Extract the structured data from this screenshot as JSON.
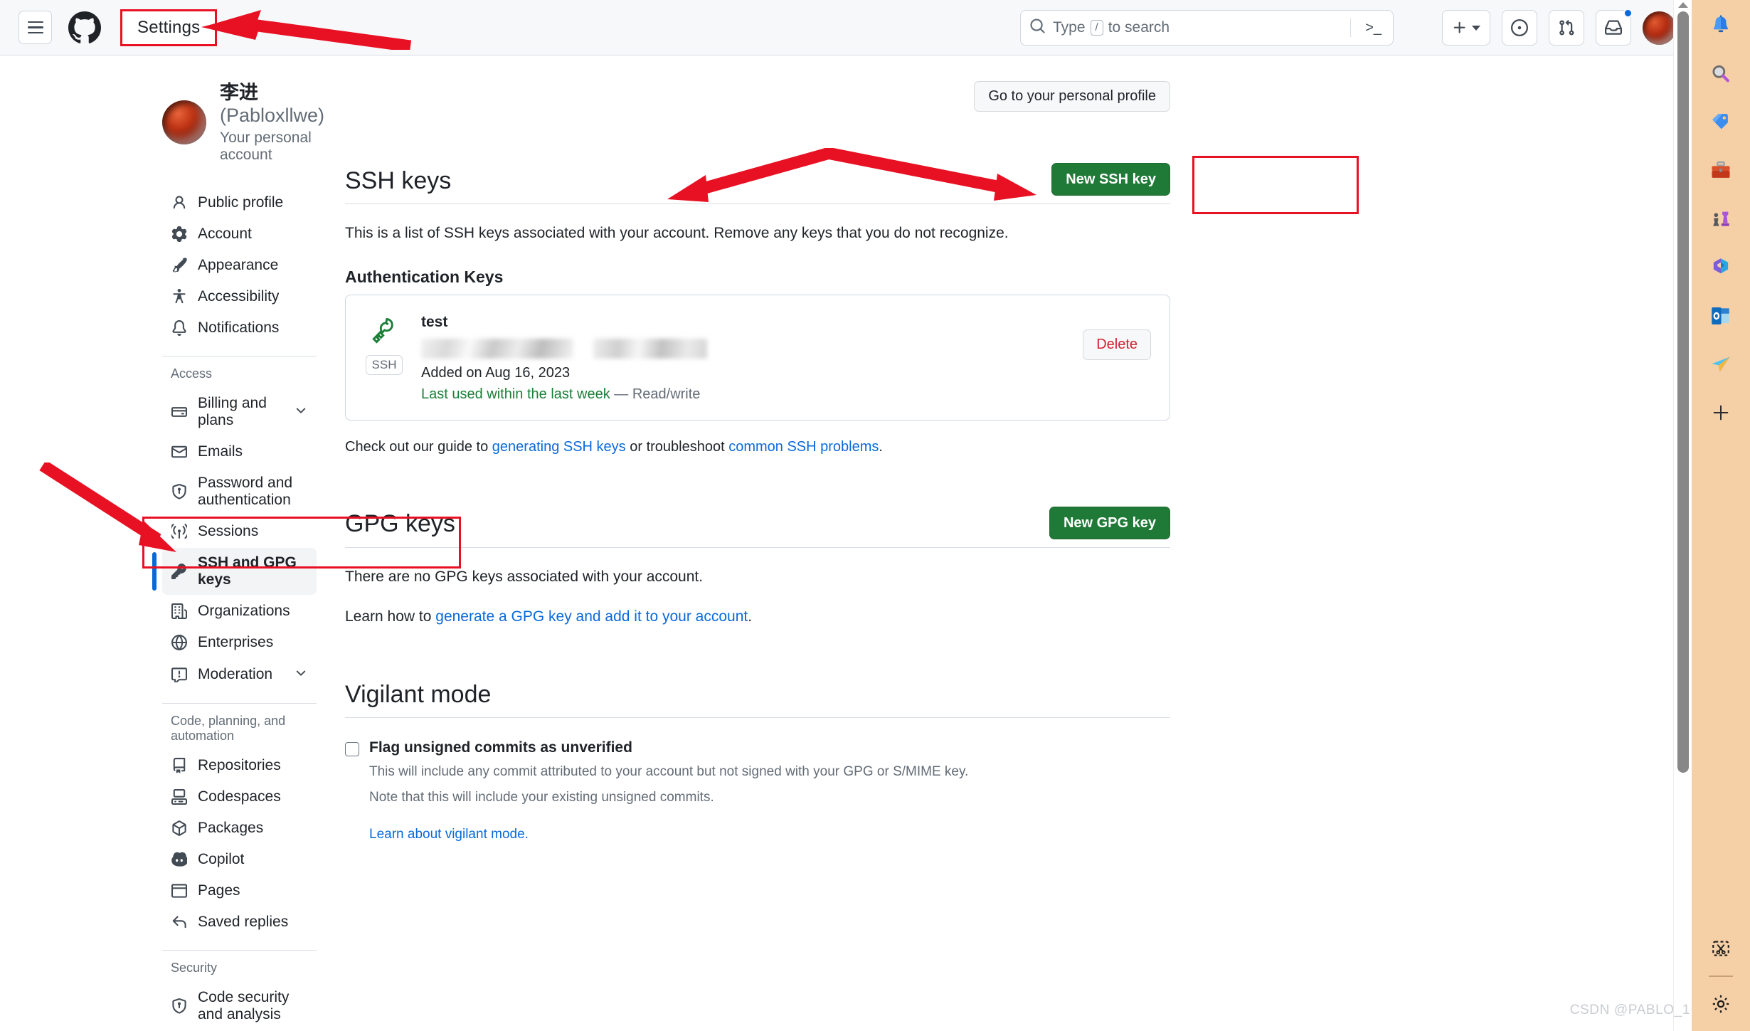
{
  "header": {
    "menu_label": "menu",
    "logo_label": "GitHub",
    "settings_label": "Settings",
    "search_placeholder": "Type",
    "search_key": "/",
    "search_suffix": "to search",
    "terminal_glyph": ">_",
    "create_label": "+",
    "issues_label": "Issues",
    "pull_requests_label": "Pull requests",
    "inbox_label": "Inbox",
    "avatar_label": "Your profile"
  },
  "profile": {
    "name": "李进",
    "handle": "(Pabloxllwe)",
    "subtitle": "Your personal account",
    "go_to_profile": "Go to your personal profile"
  },
  "sidebar": {
    "primary": [
      {
        "label": "Public profile",
        "icon": "person-icon"
      },
      {
        "label": "Account",
        "icon": "gear-icon"
      },
      {
        "label": "Appearance",
        "icon": "paintbrush-icon"
      },
      {
        "label": "Accessibility",
        "icon": "accessibility-icon"
      },
      {
        "label": "Notifications",
        "icon": "bell-icon"
      }
    ],
    "access_title": "Access",
    "access": [
      {
        "label": "Billing and plans",
        "icon": "credit-card-icon",
        "chevron": true
      },
      {
        "label": "Emails",
        "icon": "mail-icon",
        "chevron": false
      },
      {
        "label": "Password and authentication",
        "icon": "shield-lock-icon",
        "chevron": false
      },
      {
        "label": "Sessions",
        "icon": "broadcast-icon",
        "chevron": false
      },
      {
        "label": "SSH and GPG keys",
        "icon": "key-icon",
        "chevron": false,
        "active": true
      },
      {
        "label": "Organizations",
        "icon": "organization-icon",
        "chevron": false
      },
      {
        "label": "Enterprises",
        "icon": "globe-icon",
        "chevron": false
      },
      {
        "label": "Moderation",
        "icon": "report-icon",
        "chevron": true
      }
    ],
    "code_title": "Code, planning, and automation",
    "code": [
      {
        "label": "Repositories",
        "icon": "repo-icon"
      },
      {
        "label": "Codespaces",
        "icon": "codespaces-icon"
      },
      {
        "label": "Packages",
        "icon": "package-icon"
      },
      {
        "label": "Copilot",
        "icon": "copilot-icon"
      },
      {
        "label": "Pages",
        "icon": "browser-icon"
      },
      {
        "label": "Saved replies",
        "icon": "reply-icon"
      }
    ],
    "security_title": "Security",
    "security": [
      {
        "label": "Code security and analysis",
        "icon": "shield-check-icon"
      }
    ]
  },
  "ssh_section": {
    "title": "SSH keys",
    "new_button": "New SSH key",
    "description": "This is a list of SSH keys associated with your account. Remove any keys that you do not recognize.",
    "auth_keys_title": "Authentication Keys",
    "key": {
      "name": "test",
      "badge": "SSH",
      "added": "Added on Aug 16, 2023",
      "last_used": "Last used within the last week",
      "access": "— Read/write",
      "delete_label": "Delete"
    },
    "guide_prefix": "Check out our guide to ",
    "guide_link1": "generating SSH keys",
    "guide_middle": " or troubleshoot ",
    "guide_link2": "common SSH problems",
    "guide_suffix": "."
  },
  "gpg_section": {
    "title": "GPG keys",
    "new_button": "New GPG key",
    "empty_text": "There are no GPG keys associated with your account.",
    "learn_prefix": "Learn how to ",
    "learn_link": "generate a GPG key and add it to your account",
    "learn_suffix": "."
  },
  "vigilant_section": {
    "title": "Vigilant mode",
    "checkbox_label": "Flag unsigned commits as unverified",
    "note1": "This will include any commit attributed to your account but not signed with your GPG or S/MIME key.",
    "note2": "Note that this will include your existing unsigned commits.",
    "learn_link": "Learn about vigilant mode."
  },
  "right_rail": {
    "icons": [
      "bell-icon",
      "search-icon",
      "tag-icon",
      "toolbox-icon",
      "chess-icon",
      "office-icon",
      "outlook-icon",
      "send-icon",
      "plus-icon"
    ],
    "bottom_icons": [
      "screenshot-scissors-icon",
      "settings-gear-icon"
    ]
  },
  "watermark": "CSDN @PABLO_1",
  "colors": {
    "accent_green": "#1f7a37",
    "link_blue": "#0969da",
    "annotation_red": "#e81123",
    "active_bar": "#0969da",
    "danger_red": "#cf222e",
    "rail_bg": "#f5cfa6"
  }
}
